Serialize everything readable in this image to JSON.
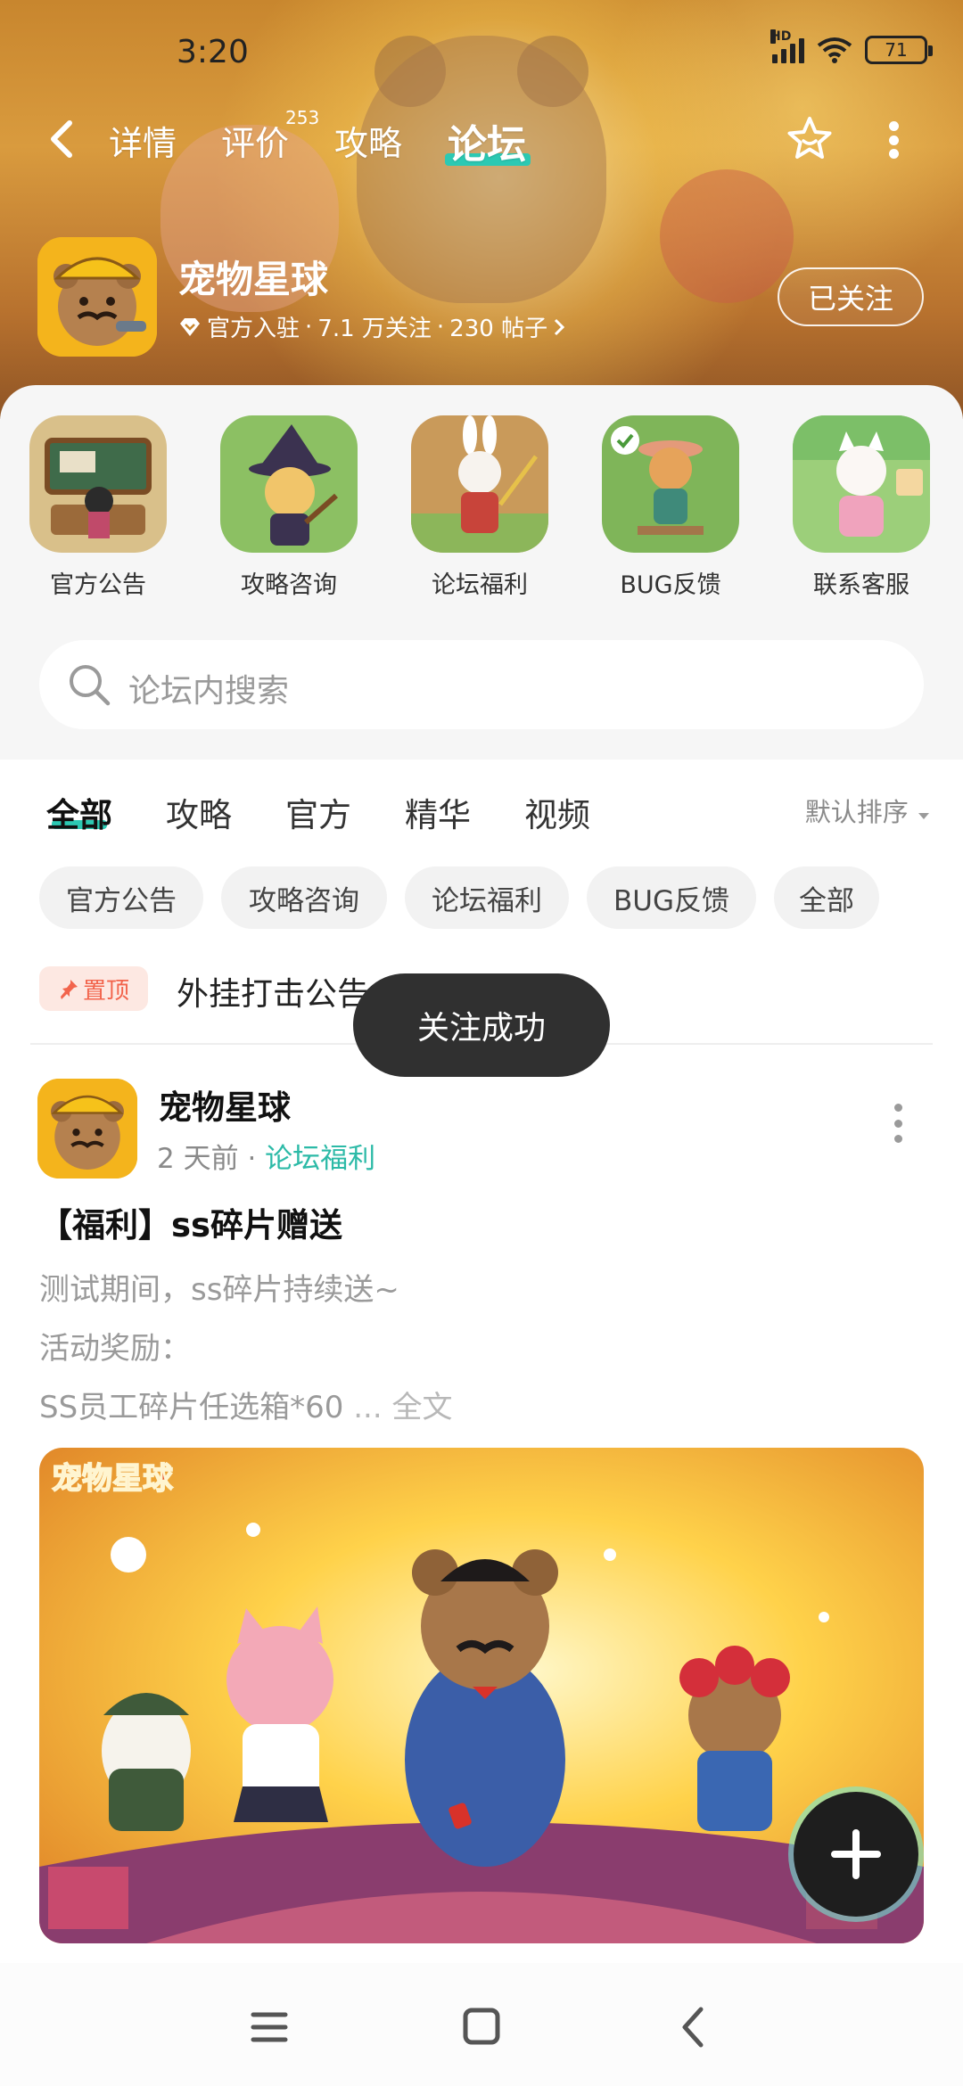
{
  "status": {
    "time": "3:20",
    "network": "HD",
    "battery": "71"
  },
  "nav": {
    "tabs": [
      {
        "label": "详情"
      },
      {
        "label": "评价",
        "badge": "253"
      },
      {
        "label": "攻略"
      },
      {
        "label": "论坛"
      }
    ],
    "active_tab": "论坛"
  },
  "game": {
    "title": "宠物星球",
    "verified": "官方入驻",
    "followers": "7.1 万关注",
    "posts": "230 帖子",
    "follow_label": "已关注"
  },
  "quick_links": [
    {
      "label": "官方公告"
    },
    {
      "label": "攻略咨询"
    },
    {
      "label": "论坛福利"
    },
    {
      "label": "BUG反馈"
    },
    {
      "label": "联系客服"
    }
  ],
  "search": {
    "placeholder": "论坛内搜索"
  },
  "forum_tabs": [
    {
      "label": "全部"
    },
    {
      "label": "攻略"
    },
    {
      "label": "官方"
    },
    {
      "label": "精华"
    },
    {
      "label": "视频"
    }
  ],
  "sort_label": "默认排序",
  "chips": [
    {
      "label": "官方公告"
    },
    {
      "label": "攻略咨询"
    },
    {
      "label": "论坛福利"
    },
    {
      "label": "BUG反馈"
    },
    {
      "label": "全部"
    }
  ],
  "pinned": {
    "badge": "置顶",
    "title": "外挂打击公告"
  },
  "post": {
    "author": "宠物星球",
    "time": "2 天前",
    "category": "论坛福利",
    "title": "【福利】ss碎片赠送",
    "lines": [
      "测试期间，ss碎片持续送~",
      "活动奖励："
    ],
    "last_line": "SS员工碎片任选箱*60",
    "ellipsis": "...",
    "fulltext": "全文",
    "image_logo": "宠物星球"
  },
  "toast": "关注成功",
  "colors": {
    "accent": "#2cc9b3",
    "pin": "#f2644c"
  }
}
